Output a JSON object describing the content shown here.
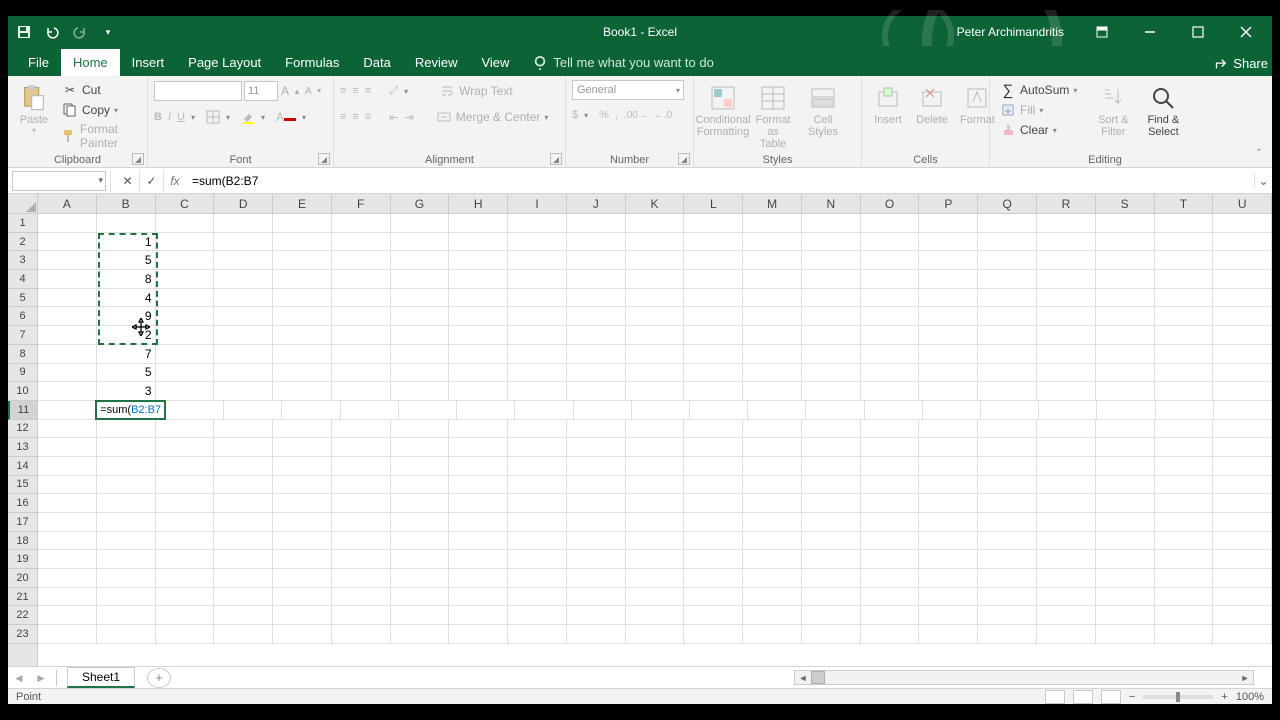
{
  "titlebar": {
    "title": "Book1  -  Excel",
    "user": "Peter Archimandritis"
  },
  "tabs": {
    "file": "File",
    "home": "Home",
    "insert": "Insert",
    "pageLayout": "Page Layout",
    "formulas": "Formulas",
    "data": "Data",
    "review": "Review",
    "view": "View",
    "tellme": "Tell me what you want to do",
    "share": "Share"
  },
  "ribbon": {
    "clipboard": {
      "paste": "Paste",
      "cut": "Cut",
      "copy": "Copy",
      "formatPainter": "Format Painter",
      "label": "Clipboard"
    },
    "font": {
      "size": "11",
      "label": "Font"
    },
    "alignment": {
      "wrap": "Wrap Text",
      "merge": "Merge & Center",
      "label": "Alignment"
    },
    "number": {
      "format": "General",
      "label": "Number"
    },
    "styles": {
      "cond": "Conditional Formatting",
      "table": "Format as Table",
      "cell": "Cell Styles",
      "label": "Styles"
    },
    "cells": {
      "insert": "Insert",
      "delete": "Delete",
      "format": "Format",
      "label": "Cells"
    },
    "editing": {
      "autosum": "AutoSum",
      "fill": "Fill",
      "clear": "Clear",
      "sort": "Sort & Filter",
      "find": "Find & Select",
      "label": "Editing"
    }
  },
  "formulaBar": {
    "nameBox": "",
    "formula": "=sum(B2:B7"
  },
  "columns": [
    "A",
    "B",
    "C",
    "D",
    "E",
    "F",
    "G",
    "H",
    "I",
    "J",
    "K",
    "L",
    "M",
    "N",
    "O",
    "P",
    "Q",
    "R",
    "S",
    "T",
    "U"
  ],
  "rows": [
    "1",
    "2",
    "3",
    "4",
    "5",
    "6",
    "7",
    "8",
    "9",
    "10",
    "11",
    "12",
    "13",
    "14",
    "15",
    "16",
    "17",
    "18",
    "19",
    "20",
    "21",
    "22",
    "23"
  ],
  "activeRow": 11,
  "cellsB": {
    "2": "1",
    "3": "5",
    "4": "8",
    "5": "4",
    "6": "9",
    "7": "2",
    "8": "7",
    "9": "5",
    "10": "3"
  },
  "editing": {
    "prefix": "=sum(",
    "ref": "B2:B7"
  },
  "sheet": {
    "name": "Sheet1"
  },
  "status": {
    "mode": "Point",
    "zoom": "100%"
  }
}
